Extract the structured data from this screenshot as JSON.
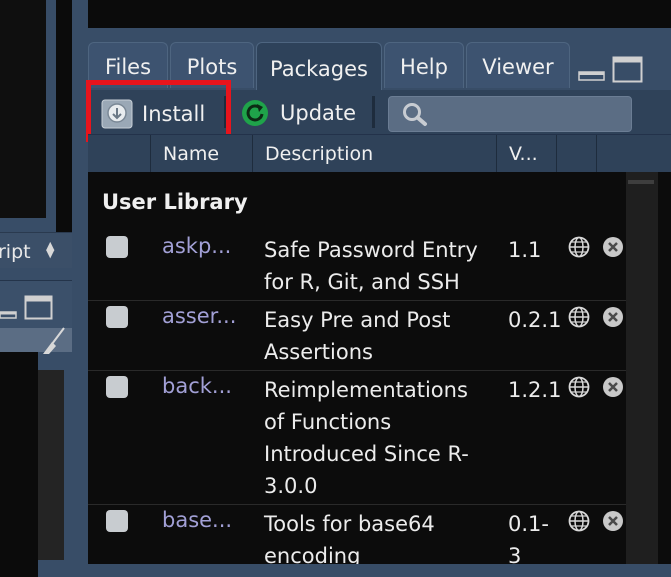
{
  "left": {
    "script_dropdown_label": "ript"
  },
  "tabs": [
    {
      "label": "Files"
    },
    {
      "label": "Plots"
    },
    {
      "label": "Packages"
    },
    {
      "label": "Help"
    },
    {
      "label": "Viewer"
    }
  ],
  "toolbar": {
    "install_label": "Install",
    "update_label": "Update",
    "search_placeholder": ""
  },
  "columns": {
    "name": "Name",
    "description": "Description",
    "version": "V..."
  },
  "library_label": "User Library",
  "packages": [
    {
      "name": "askp...",
      "desc_lines": [
        "Safe Password Entry",
        "for R, Git, and SSH"
      ],
      "version_lines": [
        "1.1"
      ]
    },
    {
      "name": "asser...",
      "desc_lines": [
        "Easy Pre and Post",
        "Assertions"
      ],
      "version_lines": [
        "0.2.1"
      ]
    },
    {
      "name": "back...",
      "desc_lines": [
        "Reimplementations",
        "of Functions",
        "Introduced Since R-",
        "3.0.0"
      ],
      "version_lines": [
        "1.2.1"
      ]
    },
    {
      "name": "base...",
      "desc_lines": [
        "Tools for base64",
        "encoding"
      ],
      "version_lines": [
        "0.1-",
        "3"
      ]
    }
  ],
  "colors": {
    "highlight": "#e8141c",
    "update_icon": "#1fa34a",
    "package_name": "#a2a0d6"
  }
}
